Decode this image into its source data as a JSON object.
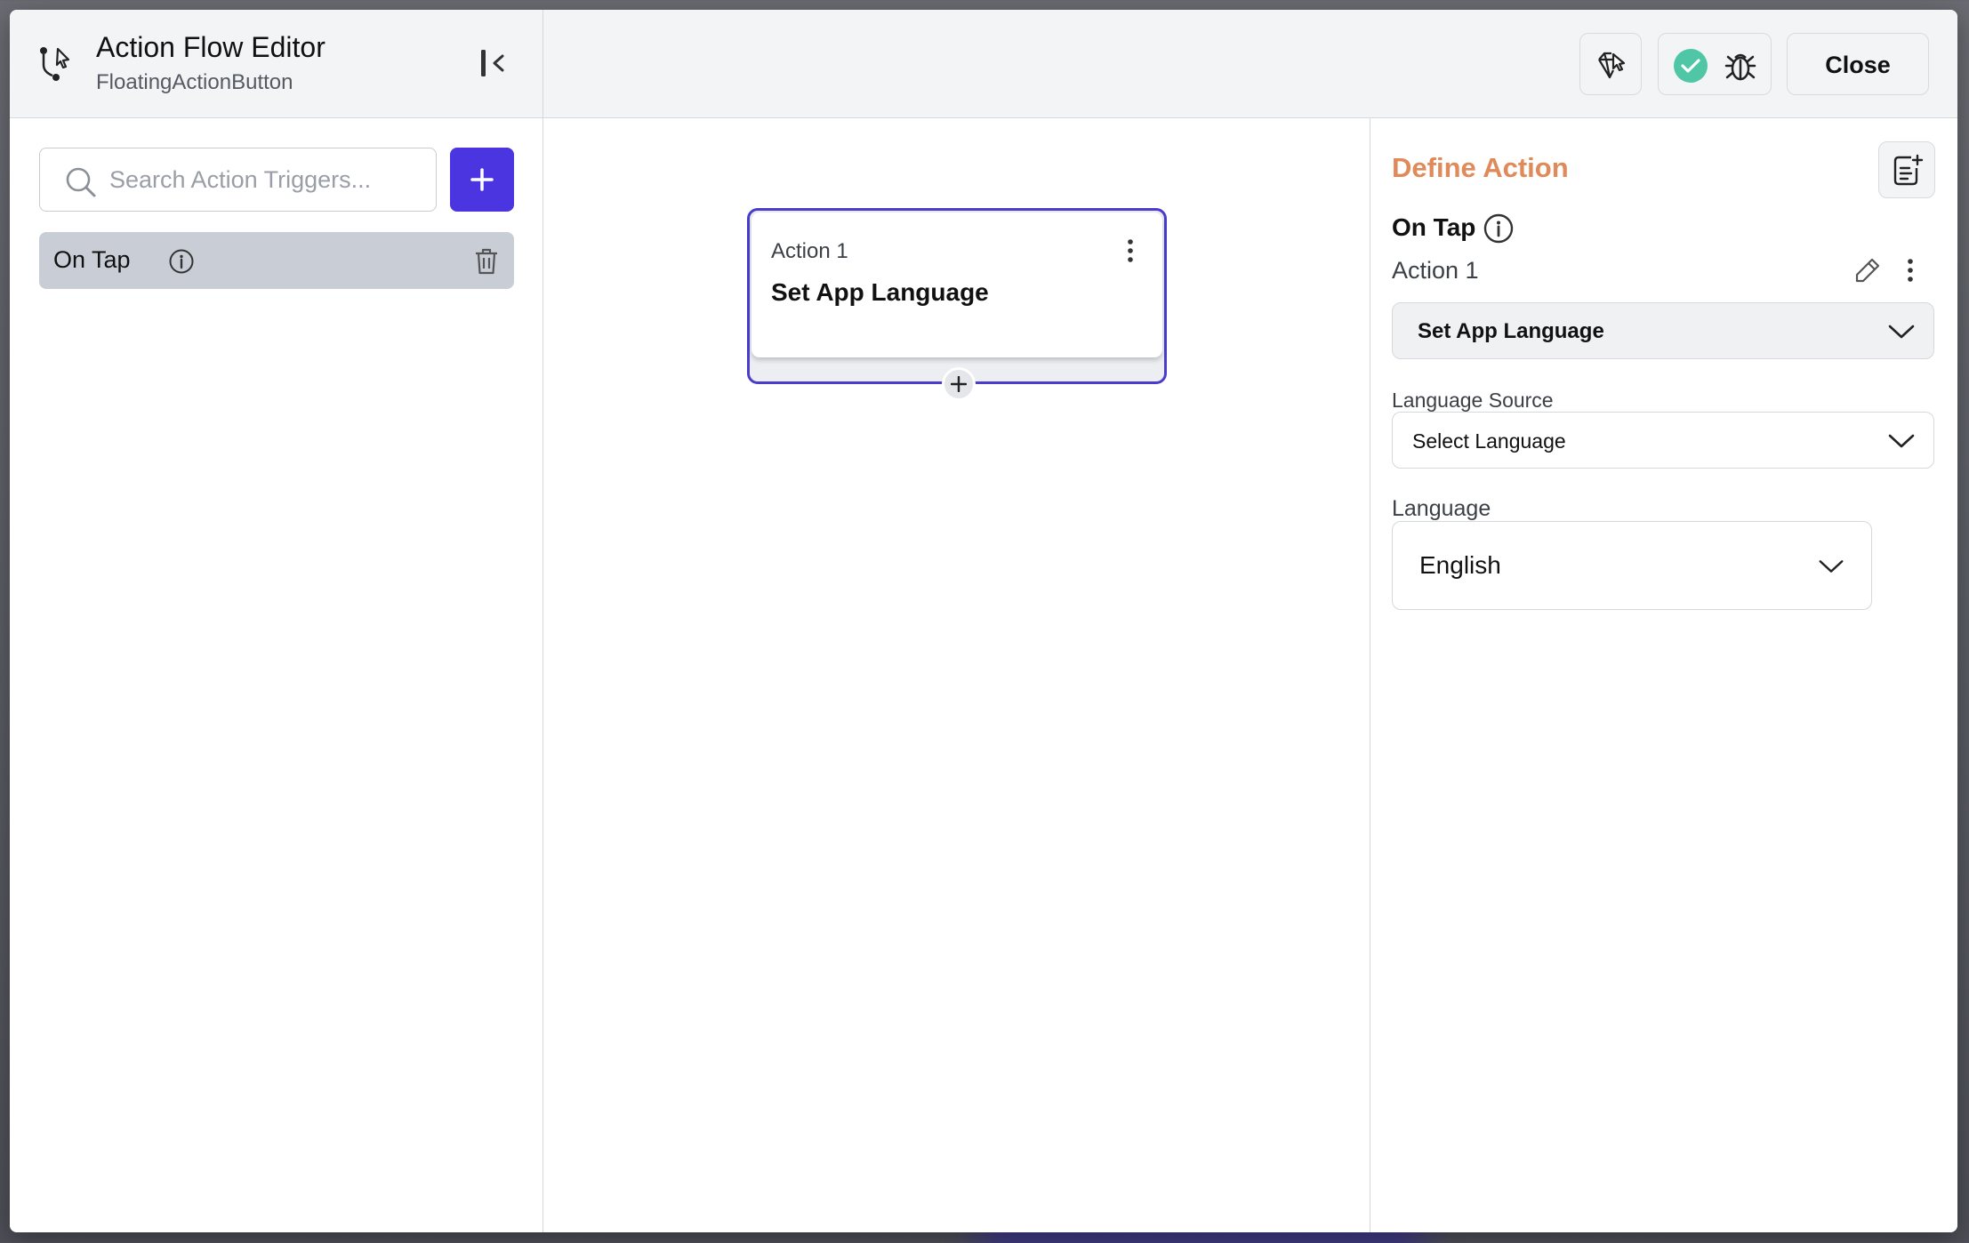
{
  "header": {
    "title": "Action Flow Editor",
    "subtitle": "FloatingActionButton",
    "icons": [
      "flow-branch-icon",
      "collapse-panel-icon"
    ]
  },
  "toolbar": {
    "gem_icon": "gem-cursor-icon",
    "status_icon": "check-circle-icon",
    "debug_icon": "bug-icon",
    "close_label": "Close"
  },
  "triggers": {
    "search_placeholder": "Search Action Triggers...",
    "items": [
      {
        "label": "On Tap"
      }
    ]
  },
  "canvas": {
    "card": {
      "label": "Action 1",
      "title": "Set App Language"
    }
  },
  "panel": {
    "title": "Define Action",
    "trigger": "On Tap",
    "action_name": "Action 1",
    "action_type": "Set App Language",
    "language_source_label": "Language Source",
    "language_source_value": "Select Language",
    "language_label": "Language",
    "language_value": "English"
  },
  "colors": {
    "accent": "#4a35e0",
    "card_border": "#4a3ccc",
    "define_title": "#e08a5a",
    "status_ok": "#4fc6a6"
  }
}
